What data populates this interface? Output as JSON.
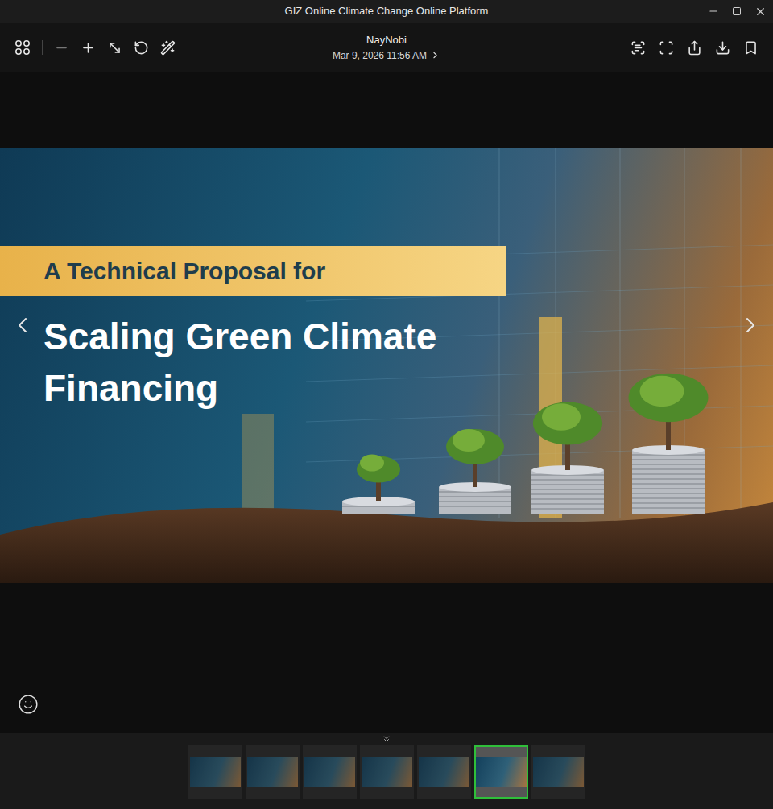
{
  "window": {
    "title": "GIZ Online Climate Change Online Platform"
  },
  "header": {
    "author": "NayNobi",
    "date": "Mar 9, 2026 11:56 AM"
  },
  "image": {
    "band": "A Technical Proposal for",
    "title": "Scaling Green Climate Financing"
  },
  "thumbnails": [
    {
      "selected": false
    },
    {
      "selected": false
    },
    {
      "selected": false
    },
    {
      "selected": false
    },
    {
      "selected": false
    },
    {
      "selected": true
    },
    {
      "selected": false
    }
  ]
}
